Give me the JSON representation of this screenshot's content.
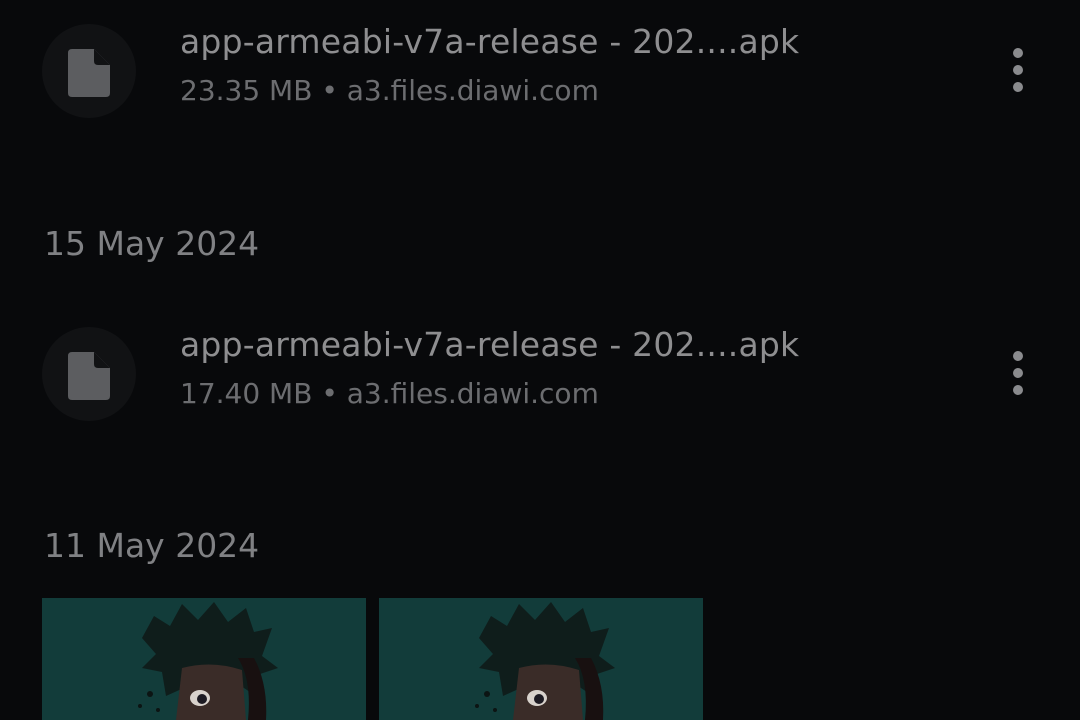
{
  "downloads": {
    "groups": [
      {
        "date": "",
        "items": [
          {
            "name": "app-armeabi-v7a-release - 202....apk",
            "meta": "23.35 MB • a3.files.diawi.com",
            "icon": "document-icon"
          }
        ]
      },
      {
        "date": "15 May 2024",
        "items": [
          {
            "name": "app-armeabi-v7a-release - 202....apk",
            "meta": "17.40 MB • a3.files.diawi.com",
            "icon": "document-icon"
          }
        ]
      },
      {
        "date": "11 May 2024",
        "thumbnails": [
          {
            "kind": "image",
            "icon": "anime-character-thumbnail"
          },
          {
            "kind": "image",
            "icon": "anime-character-thumbnail"
          }
        ]
      }
    ]
  },
  "colors": {
    "background": "#08090b",
    "primary_text": "#8e8e90",
    "secondary_text": "#6c6d70",
    "thumbnail_bg": "#123c3a"
  }
}
